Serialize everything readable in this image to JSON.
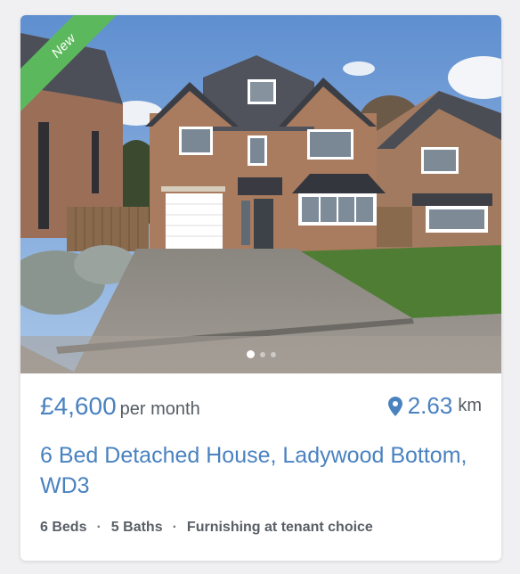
{
  "listing": {
    "badge": "New",
    "price": "£4,600",
    "price_period": "per month",
    "distance_value": "2.63",
    "distance_unit": "km",
    "title": "6 Bed Detached House, Ladywood Bottom, WD3",
    "beds": "6 Beds",
    "baths": "5 Baths",
    "furnishing": "Furnishing at tenant choice",
    "separator": "·"
  },
  "gallery": {
    "current_image": 1,
    "image_count": 3
  },
  "colors": {
    "accent": "#4a82c0",
    "badge": "#5cb85c",
    "muted_text": "#555b63"
  },
  "icons": {
    "distance": "map-pin-icon"
  }
}
